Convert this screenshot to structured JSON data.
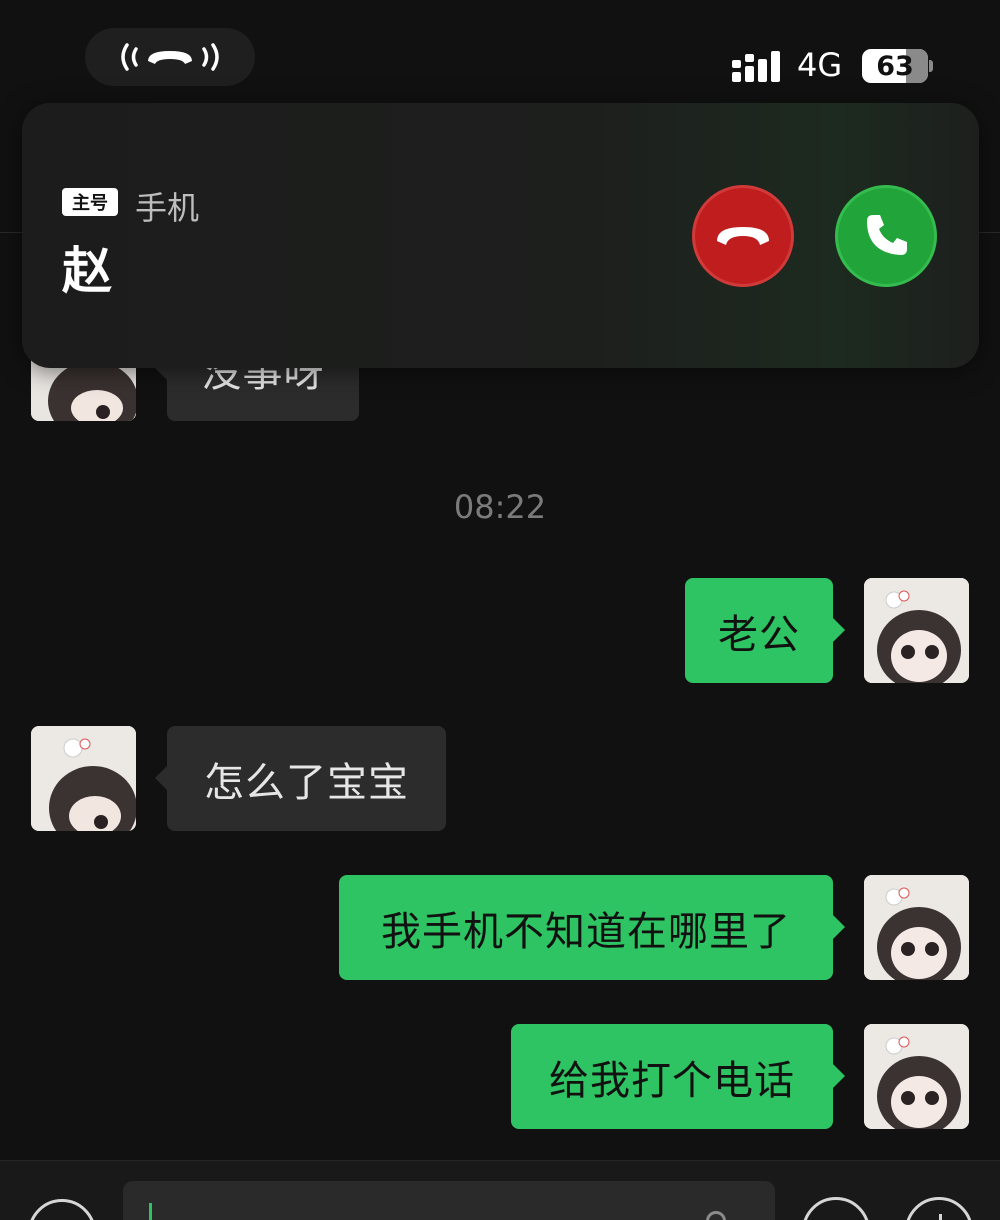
{
  "status_bar": {
    "network": "4G",
    "battery": "63",
    "call_indicator_icon": "ongoing-call-icon",
    "signal_icon": "signal-bars-icon"
  },
  "chat": {
    "partial_message": "没事呀",
    "timestamp": "08:22",
    "messages": [
      {
        "side": "out",
        "text": "老公"
      },
      {
        "side": "in",
        "text": "怎么了宝宝"
      },
      {
        "side": "out",
        "text": "我手机不知道在哪里了"
      },
      {
        "side": "out",
        "text": "给我打个电话"
      }
    ]
  },
  "incoming_call": {
    "sim_tag": "主号",
    "device": "手机",
    "caller": "赵",
    "decline_icon": "hang-up-icon",
    "accept_icon": "phone-icon"
  },
  "colors": {
    "background": "#111111",
    "outgoing_bubble": "#2fc463",
    "incoming_bubble": "#2c2c2c",
    "decline": "#c01e1e",
    "accept": "#21a43a"
  },
  "input_bar": {
    "voice_icon": "voice-icon",
    "emoji_icon": "emoji-icon",
    "plus_icon": "plus-icon"
  }
}
